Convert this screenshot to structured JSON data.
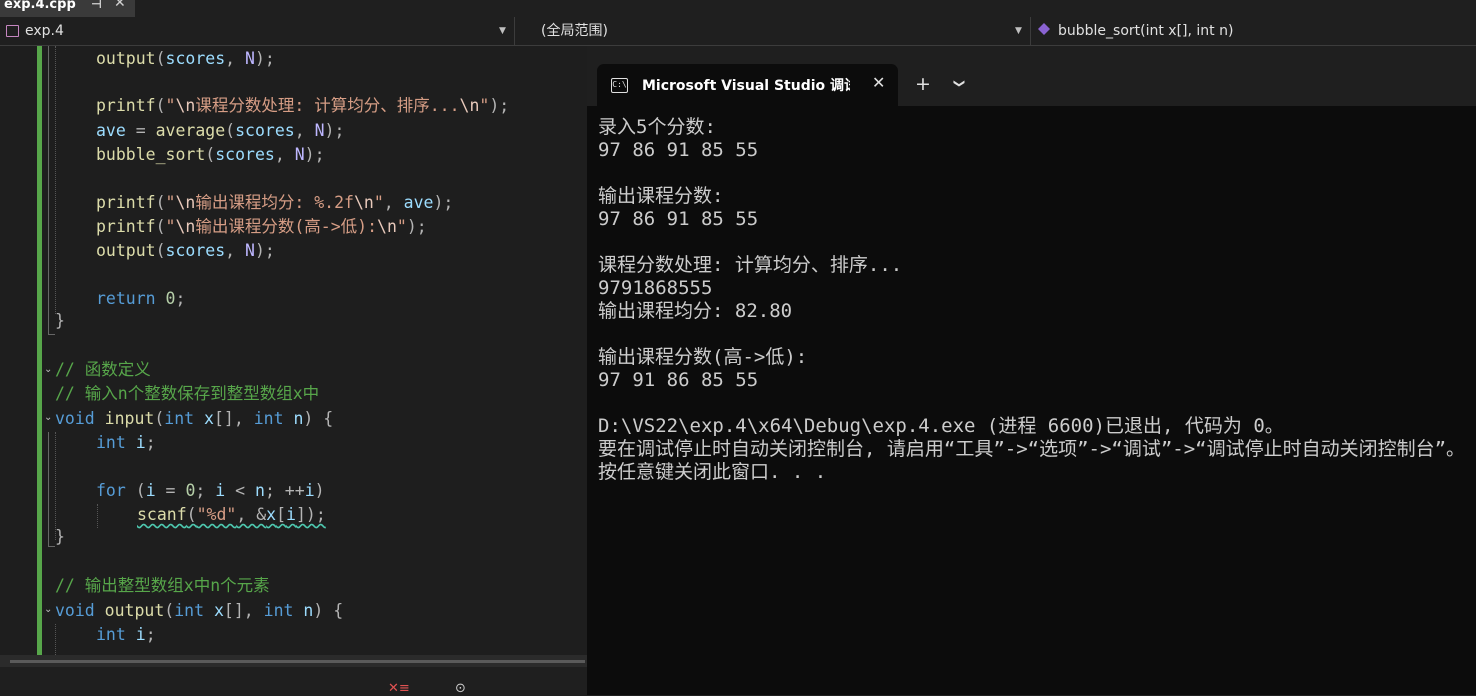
{
  "tab": {
    "title": "exp.4.cpp"
  },
  "nav": {
    "project": "exp.4",
    "scope": "(全局范围)",
    "function": "bubble_sort(int x[], int n)"
  },
  "code": {
    "l1": {
      "fn": "output",
      "a": "scores",
      "sep": ", ",
      "m": "N",
      "end": ");"
    },
    "l2": {
      "fn": "printf",
      "open": "(",
      "s1": "\"",
      "e1": "\\n",
      "s2": "课程分数处理: 计算均分、排序...",
      "e2": "\\n",
      "s3": "\"",
      "end": ");"
    },
    "l3": {
      "v": "ave",
      "eq": " = ",
      "fn": "average",
      "open": "(",
      "a": "scores",
      "sep": ", ",
      "m": "N",
      "end": ");"
    },
    "l4": {
      "fn": "bubble_sort",
      "open": "(",
      "a": "scores",
      "sep": ", ",
      "m": "N",
      "end": ");"
    },
    "l5": {
      "fn": "printf",
      "open": "(",
      "s1": "\"",
      "e1": "\\n",
      "s2": "输出课程均分: %.2f",
      "e2": "\\n",
      "s3": "\"",
      "sep": ", ",
      "a": "ave",
      "end": ");"
    },
    "l6": {
      "fn": "printf",
      "open": "(",
      "s1": "\"",
      "e1": "\\n",
      "s2": "输出课程分数(高->低):",
      "e2": "\\n",
      "s3": "\"",
      "end": ");"
    },
    "l7": {
      "fn": "output",
      "a": "scores",
      "sep": ", ",
      "m": "N",
      "end": ");"
    },
    "l8": {
      "kw": "return",
      "n": " 0",
      "end": ";"
    },
    "l9": {
      "b": "}"
    },
    "l10": {
      "c": "// 函数定义"
    },
    "l11": {
      "c": "// 输入n个整数保存到整型数组x中"
    },
    "l12": {
      "kw1": "void",
      "fn": " input",
      "open": "(",
      "kw2": "int",
      "p1": " x",
      "p1s": "[], ",
      "kw3": "int",
      "p2": " n",
      "end": ") {"
    },
    "l13": {
      "kw": "int",
      "v": " i",
      "end": ";"
    },
    "l14": {
      "kw": "for",
      "o": " (",
      "v1": "i",
      "eq": " = ",
      "n0": "0",
      "s1": "; ",
      "v2": "i",
      "lt": " < ",
      "v3": "n",
      "s2": "; ++",
      "v4": "i",
      "c": ")"
    },
    "l15": {
      "fn": "scanf",
      "open": "(",
      "str": "\"%d\"",
      "sep": ", &",
      "v": "x",
      "b1": "[",
      "i": "i",
      "end": "]);"
    },
    "l16": {
      "b": "}"
    },
    "l17": {
      "c": "// 输出整型数组x中n个元素"
    },
    "l18": {
      "kw1": "void",
      "fn": " output",
      "open": "(",
      "kw2": "int",
      "p1": " x",
      "p1s": "[], ",
      "kw3": "int",
      "p2": " n",
      "end": ") {"
    },
    "l19": {
      "kw": "int",
      "v": " i",
      "end": ";"
    }
  },
  "console": {
    "tab_title": "Microsoft Visual Studio 调试控制台",
    "icon_glyph": "C:\\",
    "new_tab_glyph": "+",
    "lines": [
      "录入5个分数:",
      "97 86 91 85 55",
      "",
      "输出课程分数:",
      "97 86 91 85 55",
      "",
      "课程分数处理: 计算均分、排序...",
      "9791868555",
      "输出课程均分: 82.80",
      "",
      "输出课程分数(高->低):",
      "97 91 86 85 55",
      "",
      "D:\\VS22\\exp.4\\x64\\Debug\\exp.4.exe (进程 6600)已退出, 代码为 0。",
      "要在调试停止时自动关闭控制台, 请启用“工具”->“选项”->“调试”->“调试停止时自动关闭控制台”。",
      "按任意键关闭此窗口. . ."
    ]
  },
  "colors": {
    "editor_bg": "#1e1e1e",
    "console_bg": "#0c0c0c",
    "keyword": "#569cd6",
    "function": "#dcdcaa",
    "variable": "#9cdcfe",
    "string": "#d69d85",
    "comment": "#57a64a",
    "macro": "#beb7ff"
  }
}
